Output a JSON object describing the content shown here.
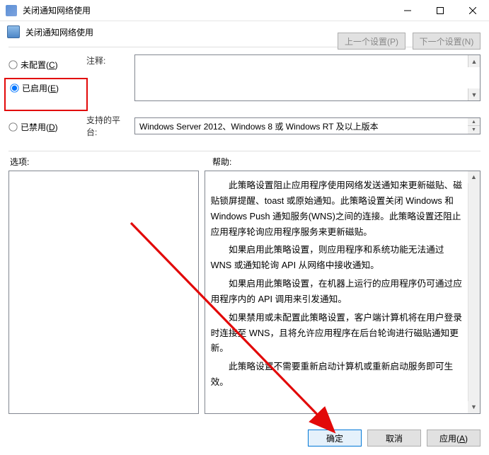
{
  "window": {
    "title": "关闭通知网络使用",
    "subtitle": "关闭通知网络使用"
  },
  "nav": {
    "prev": "上一个设置(P)",
    "next": "下一个设置(N)"
  },
  "radios": {
    "not_configured": "未配置(C)",
    "enabled": "已启用(E)",
    "disabled": "已禁用(D)"
  },
  "labels": {
    "annotation": "注释:",
    "platform": "支持的平台:",
    "options": "选项:",
    "help": "帮助:"
  },
  "platform_text": "Windows Server 2012、Windows 8 或 Windows RT 及以上版本",
  "help_paragraphs": {
    "p1": "此策略设置阻止应用程序使用网络发送通知来更新磁贴、磁贴锁屏提醒、toast 或原始通知。此策略设置关闭 Windows 和 Windows Push 通知服务(WNS)之间的连接。此策略设置还阻止应用程序轮询应用程序服务来更新磁贴。",
    "p2": "如果启用此策略设置，则应用程序和系统功能无法通过 WNS 或通知轮询 API 从网络中接收通知。",
    "p3": "如果启用此策略设置，在机器上运行的应用程序仍可通过应用程序内的 API 调用来引发通知。",
    "p4": "如果禁用或未配置此策略设置，客户端计算机将在用户登录时连接至 WNS，且将允许应用程序在后台轮询进行磁贴通知更新。",
    "p5": "此策略设置不需要重新启动计算机或重新启动服务即可生效。"
  },
  "buttons": {
    "ok": "确定",
    "cancel": "取消",
    "apply": "应用(A)"
  }
}
